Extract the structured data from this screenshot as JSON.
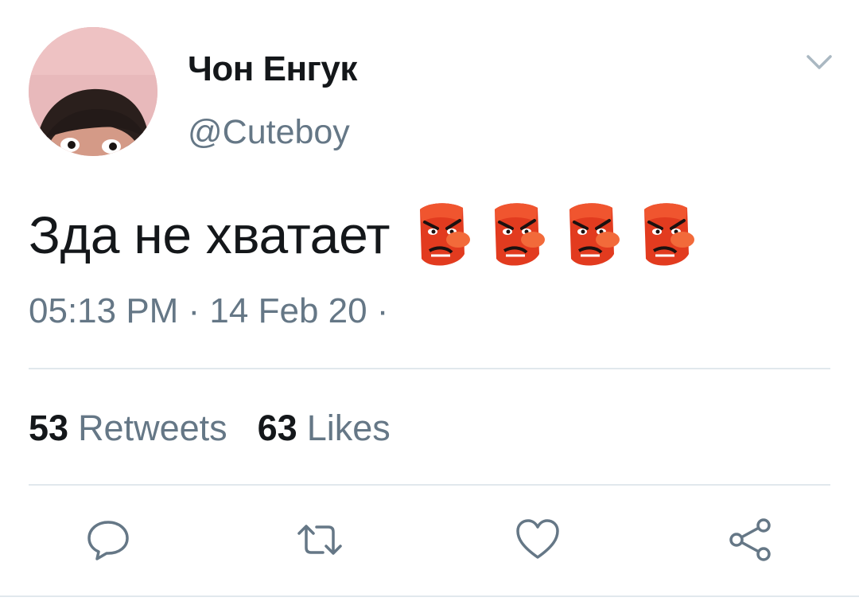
{
  "user": {
    "display_name": "Чон Енгук",
    "handle": "@Cuteboy"
  },
  "tweet": {
    "text": "Зда не хватает",
    "emoji": [
      "japanese-goblin-emoji",
      "japanese-goblin-emoji",
      "japanese-goblin-emoji",
      "japanese-goblin-emoji"
    ],
    "timestamp": "05:13 PM · 14 Feb 20 ·"
  },
  "stats": {
    "retweets_count": "53",
    "retweets_label": "Retweets",
    "likes_count": "63",
    "likes_label": "Likes"
  },
  "actions": [
    "reply-icon",
    "retweet-icon",
    "like-icon",
    "share-icon"
  ],
  "icons": {
    "menu": "chevron-down-icon"
  },
  "colors": {
    "text_primary": "#14171a",
    "text_secondary": "#657786",
    "divider": "#e1e8ed"
  }
}
